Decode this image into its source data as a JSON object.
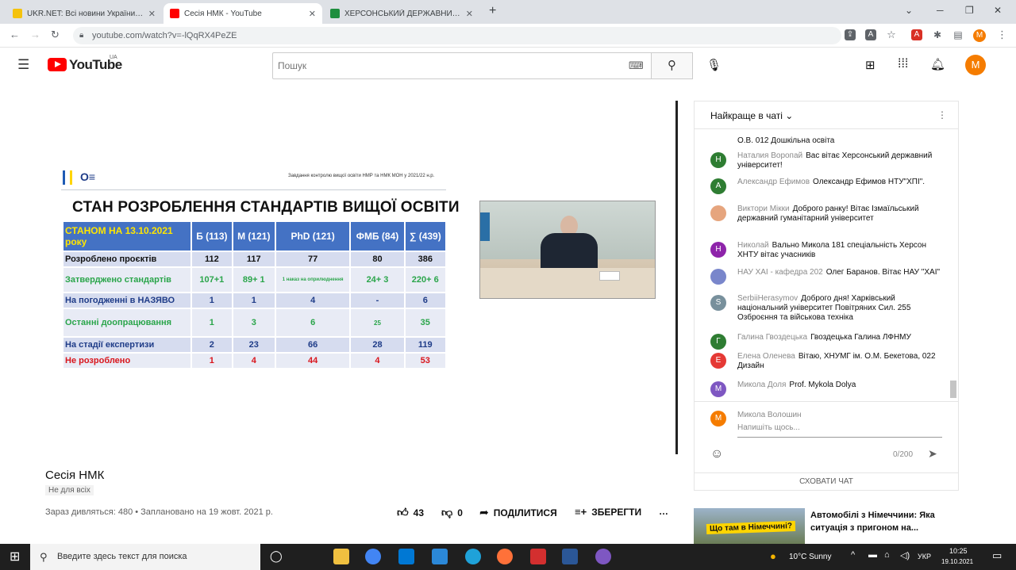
{
  "browser": {
    "tabs": [
      {
        "title": "UKR.NET: Всі новини України, о…",
        "active": false,
        "color": "#f4c20d"
      },
      {
        "title": "Сесія НМК - YouTube",
        "active": true,
        "color": "#ff0000"
      },
      {
        "title": "ХЕРСОНСЬКИЙ ДЕРЖАВНИЙ АГ…",
        "active": false,
        "color": "#1e8e3e"
      }
    ],
    "new_tab": "+",
    "url": "youtube.com/watch?v=-lQqRX4PeZE",
    "profile_initial": "M"
  },
  "youtube": {
    "logo_text": "YouTube",
    "logo_region": "UA",
    "search_placeholder": "Пошук",
    "profile_initial": "M"
  },
  "slide": {
    "header_right": "Завдання контролю вищої освіти НМР та НМК МОН у 2021/22 н.р.",
    "title": "СТАН РОЗРОБЛЕННЯ СТАНДАРТІВ ВИЩОЇ ОСВІТИ",
    "columns": [
      "СТАНОМ НА 13.10.2021 року",
      "Б (113)",
      "М (121)",
      "PhD (121)",
      "ФМБ (84)",
      "∑ (439)"
    ],
    "rows": [
      {
        "label": "Розроблено проєктів",
        "color": "#111111",
        "values": [
          "112",
          "117",
          "77",
          "80",
          "386"
        ]
      },
      {
        "label": "Затверджено стандартів",
        "color": "#2aa54a",
        "values": [
          "107+1",
          "89+ 1",
          "1 наказ на оприлюднення",
          "24+ 3",
          "220+ 6"
        ]
      },
      {
        "label": "На погодженні в НАЗЯВО",
        "color": "#1f3c88",
        "values": [
          "1",
          "1",
          "4",
          "-",
          "6"
        ]
      },
      {
        "label": "Останні доопрацювання",
        "color": "#2aa54a",
        "values": [
          "1",
          "3",
          "6",
          "25",
          "35"
        ]
      },
      {
        "label": "На стадії експертизи",
        "color": "#1f3c88",
        "values": [
          "2",
          "23",
          "66",
          "28",
          "119"
        ]
      },
      {
        "label": "Не розроблено",
        "color": "#d9151c",
        "values": [
          "1",
          "4",
          "44",
          "4",
          "53"
        ]
      }
    ]
  },
  "chat": {
    "header": "Найкраще в чаті",
    "top_partial": "О.В. 012 Дошкільна освіта",
    "messages": [
      {
        "initial": "Н",
        "color": "#2e7d32",
        "author": "Наталия Воропай",
        "text": "Вас вітає Херсонський державний університет!"
      },
      {
        "initial": "А",
        "color": "#2e7d32",
        "author": "Александр Ефимов",
        "text": "Олександр Ефимов НТУ\"ХПІ\"."
      },
      {
        "initial": "",
        "color": "#e6a57e",
        "author": "Виктори Мікки",
        "text": "Доброго ранку! Вітає Ізмаїльський державний гуманітарний університет"
      },
      {
        "initial": "Н",
        "color": "#8e24aa",
        "author": "Николай",
        "text": "Вально Микола 181 спеціальність Херсон ХНТУ вітає учасників"
      },
      {
        "initial": "",
        "color": "#7986cb",
        "author": "НАУ ХАІ - кафедра 202",
        "text": "Олег Баранов. Вітає НАУ \"ХАІ\""
      },
      {
        "initial": "S",
        "color": "#78909c",
        "author": "SerbiiHerasymov",
        "text": "Доброго дня! Харківський національний університет Повітряних Сил. 255 Озброєння та військова техніка"
      },
      {
        "initial": "Г",
        "color": "#2e7d32",
        "author": "Галина Гвоздецька",
        "text": "Гвоздецька Галина ЛФНМУ"
      },
      {
        "initial": "Е",
        "color": "#e53935",
        "author": "Елена Оленева",
        "text": "Вітаю, ХНУМГ ім. О.М. Бекетова, 022 Дизайн"
      },
      {
        "initial": "М",
        "color": "#7e57c2",
        "author": "Микола Доля",
        "text": "Prof. Mykola Dolya"
      }
    ],
    "input_user": "Микола Волошин",
    "input_placeholder": "Напишіть щось...",
    "char_count": "0/200",
    "hide_chat": "СХОВАТИ ЧАТ"
  },
  "video": {
    "title": "Сесія НМК",
    "badge": "Не для всіх",
    "stats": "Зараз дивляться: 480 • Заплановано на 19 жовт. 2021 р.",
    "likes": "43",
    "dislikes": "0",
    "share": "ПОДІЛИТИСЯ",
    "save": "ЗБЕРЕГТИ",
    "more": "…"
  },
  "related": {
    "thumb_text": "Що там в Німеччині?",
    "title": "Автомобілі з Німеччини: Яка ситуація з пригоном на..."
  },
  "taskbar": {
    "search_placeholder": "Введите здесь текст для поиска",
    "weather": "10°C  Sunny",
    "language": "УКР",
    "time": "10:25",
    "date": "19.10.2021"
  }
}
